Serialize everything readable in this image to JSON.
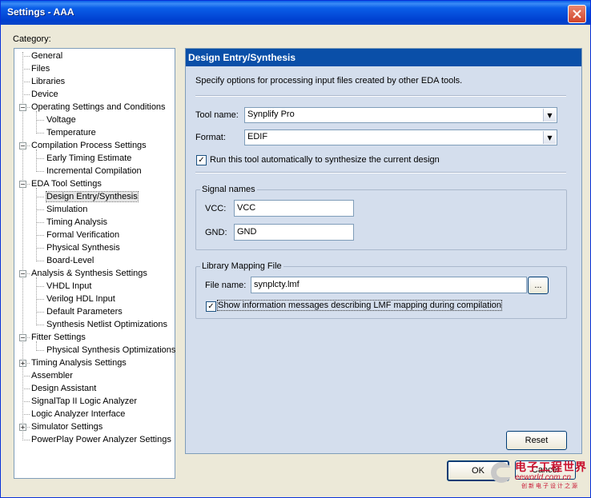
{
  "window": {
    "title": "Settings - AAA"
  },
  "category_label": "Category:",
  "tree": {
    "items": [
      {
        "label": "General"
      },
      {
        "label": "Files"
      },
      {
        "label": "Libraries"
      },
      {
        "label": "Device"
      },
      {
        "label": "Operating Settings and Conditions"
      },
      {
        "label": "Voltage"
      },
      {
        "label": "Temperature"
      },
      {
        "label": "Compilation Process Settings"
      },
      {
        "label": "Early Timing Estimate"
      },
      {
        "label": "Incremental Compilation"
      },
      {
        "label": "EDA Tool Settings"
      },
      {
        "label": "Design Entry/Synthesis"
      },
      {
        "label": "Simulation"
      },
      {
        "label": "Timing Analysis"
      },
      {
        "label": "Formal Verification"
      },
      {
        "label": "Physical Synthesis"
      },
      {
        "label": "Board-Level"
      },
      {
        "label": "Analysis & Synthesis Settings"
      },
      {
        "label": "VHDL Input"
      },
      {
        "label": "Verilog HDL Input"
      },
      {
        "label": "Default Parameters"
      },
      {
        "label": "Synthesis Netlist Optimizations"
      },
      {
        "label": "Fitter Settings"
      },
      {
        "label": "Physical Synthesis Optimizations"
      },
      {
        "label": "Timing Analysis Settings"
      },
      {
        "label": "Assembler"
      },
      {
        "label": "Design Assistant"
      },
      {
        "label": "SignalTap II Logic Analyzer"
      },
      {
        "label": "Logic Analyzer Interface"
      },
      {
        "label": "Simulator Settings"
      },
      {
        "label": "PowerPlay Power Analyzer Settings"
      }
    ]
  },
  "panel": {
    "header": "Design Entry/Synthesis",
    "description": "Specify options for processing input files created by other EDA tools.",
    "tool_name_label": "Tool name:",
    "tool_name_value": "Synplify Pro",
    "format_label": "Format:",
    "format_value": "EDIF",
    "run_auto_label": "Run this tool automatically to synthesize the current design",
    "signal_group_title": "Signal names",
    "vcc_label": "VCC:",
    "vcc_value": "VCC",
    "gnd_label": "GND:",
    "gnd_value": "GND",
    "lib_group_title": "Library Mapping File",
    "file_name_label": "File name:",
    "file_name_value": "synplcty.lmf",
    "browse_label": "...",
    "show_info_label": "Show information messages describing LMF mapping during compilation",
    "reset_label": "Reset"
  },
  "footer": {
    "ok_label": "OK",
    "cancel_label": "Cancel"
  },
  "watermark": {
    "line1": "电子工程世界",
    "line2": "eeworld.com.cn",
    "line3": "创新电子设计之源"
  }
}
